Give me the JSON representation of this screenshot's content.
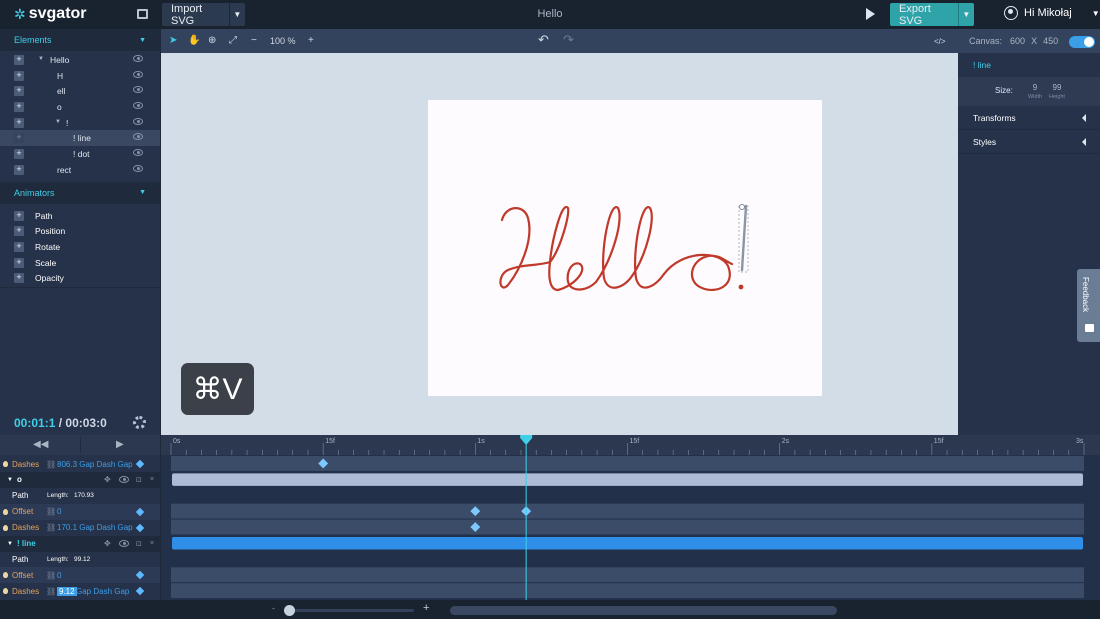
{
  "topbar": {
    "logo": "svgator",
    "import_label": "Import SVG",
    "doc_title": "Hello",
    "export_label": "Export SVG",
    "user_label": "Hi Mikołaj"
  },
  "left_panel": {
    "elements_header": "Elements",
    "tree": [
      {
        "label": "Hello"
      },
      {
        "label": "H"
      },
      {
        "label": "ell"
      },
      {
        "label": "o"
      },
      {
        "label": "!"
      },
      {
        "label": "! line"
      },
      {
        "label": "! dot"
      },
      {
        "label": "rect"
      }
    ],
    "animators_header": "Animators",
    "animators": [
      "Path",
      "Position",
      "Rotate",
      "Scale",
      "Opacity"
    ],
    "time_current": "00:01:1",
    "time_total": "00:03:0",
    "time_sep": " / "
  },
  "canvas_toolbar": {
    "zoom": "100 %",
    "minus": "−",
    "plus": "+",
    "code_icon": "</>"
  },
  "canvas": {
    "artboard_text": "Hello!",
    "shortcut": "⌘V"
  },
  "right_panel": {
    "canvas_label": "Canvas:",
    "canvas_w": "600",
    "canvas_x": "X",
    "canvas_h": "450",
    "selected": "! line",
    "size_label": "Size:",
    "width_value": "9",
    "width_caption": "Width",
    "height_value": "99",
    "height_caption": "Height",
    "sections": [
      "Transforms",
      "Styles"
    ],
    "feedback": "Feedback"
  },
  "timeline": {
    "ticks": [
      "0s",
      "15f",
      "1s",
      "15f",
      "2s",
      "15f",
      "3s"
    ],
    "tick_positions_pct": [
      0,
      16.67,
      33.33,
      50,
      66.67,
      83.33,
      100
    ],
    "playhead_pct": 38.9,
    "rows": [
      {
        "kind": "prop",
        "name": "Dashes",
        "value": "806.3 Gap Dash Gap",
        "keyframes_pct": [
          16.67
        ]
      },
      {
        "kind": "element",
        "name": "o"
      },
      {
        "kind": "path",
        "name": "Path",
        "length_label": "Length:",
        "length": "170.93"
      },
      {
        "kind": "prop",
        "name": "Offset",
        "value": "0",
        "keyframes_pct": [
          33.33,
          38.9
        ]
      },
      {
        "kind": "prop",
        "name": "Dashes",
        "value": "170.1 Gap Dash Gap",
        "keyframes_pct": [
          33.33
        ]
      },
      {
        "kind": "element",
        "name": "! line"
      },
      {
        "kind": "path",
        "name": "Path",
        "length_label": "Length:",
        "length": "99.12"
      },
      {
        "kind": "prop",
        "name": "Offset",
        "value": "0",
        "keyframes_pct": []
      },
      {
        "kind": "prop",
        "name": "Dashes",
        "value": "9.12",
        "value_suffix": "Gap Dash Gap",
        "keyframes_pct": []
      }
    ],
    "bottom_minus": "-",
    "bottom_plus": "+"
  },
  "colors": {
    "accent": "#3fd0e8",
    "keyframe": "#7cc8ff",
    "export_button": "#2ea4a8",
    "stroke": "#c0392b"
  }
}
